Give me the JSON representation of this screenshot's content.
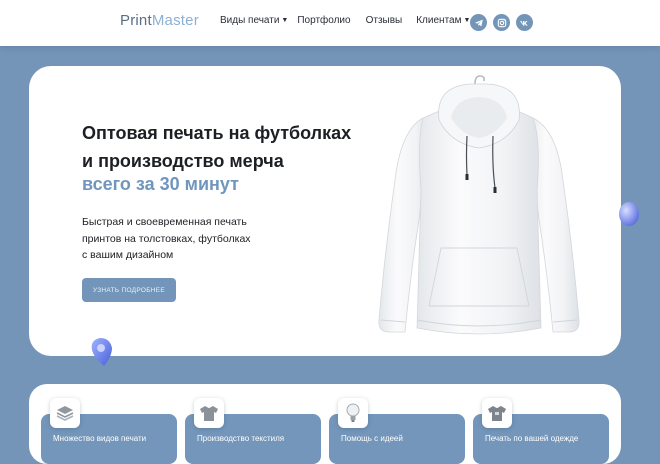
{
  "header": {
    "logo_part1": "Print",
    "logo_part2": "Master",
    "nav": [
      {
        "label": "Виды печати",
        "has_dropdown": true
      },
      {
        "label": "Портфолио",
        "has_dropdown": false
      },
      {
        "label": "Отзывы",
        "has_dropdown": false
      },
      {
        "label": "Клиентам",
        "has_dropdown": true
      }
    ],
    "social": [
      "telegram-icon",
      "instagram-icon",
      "vk-icon"
    ]
  },
  "hero": {
    "title_line1": "Оптовая печать на футболках",
    "title_line2": "и производство мерча",
    "accent": "всего за 30 минут",
    "desc_line1": "Быстрая и своевременная печать",
    "desc_line2": "принтов на толстовках, футболках",
    "desc_line3": "с вашим дизайном",
    "button_label": "УЗНАТЬ ПОДРОБНЕЕ"
  },
  "features": [
    {
      "label": "Множество видов печати",
      "icon": "layers-icon"
    },
    {
      "label": "Производство текстиля",
      "icon": "tshirt-icon"
    },
    {
      "label": "Помощь с идеей",
      "icon": "lightbulb-icon"
    },
    {
      "label": "Печать по вашей одежде",
      "icon": "tshirt-print-icon"
    }
  ],
  "colors": {
    "background": "#7495b8",
    "accent": "#7096bd",
    "button": "#7295b9",
    "card": "#ffffff"
  }
}
